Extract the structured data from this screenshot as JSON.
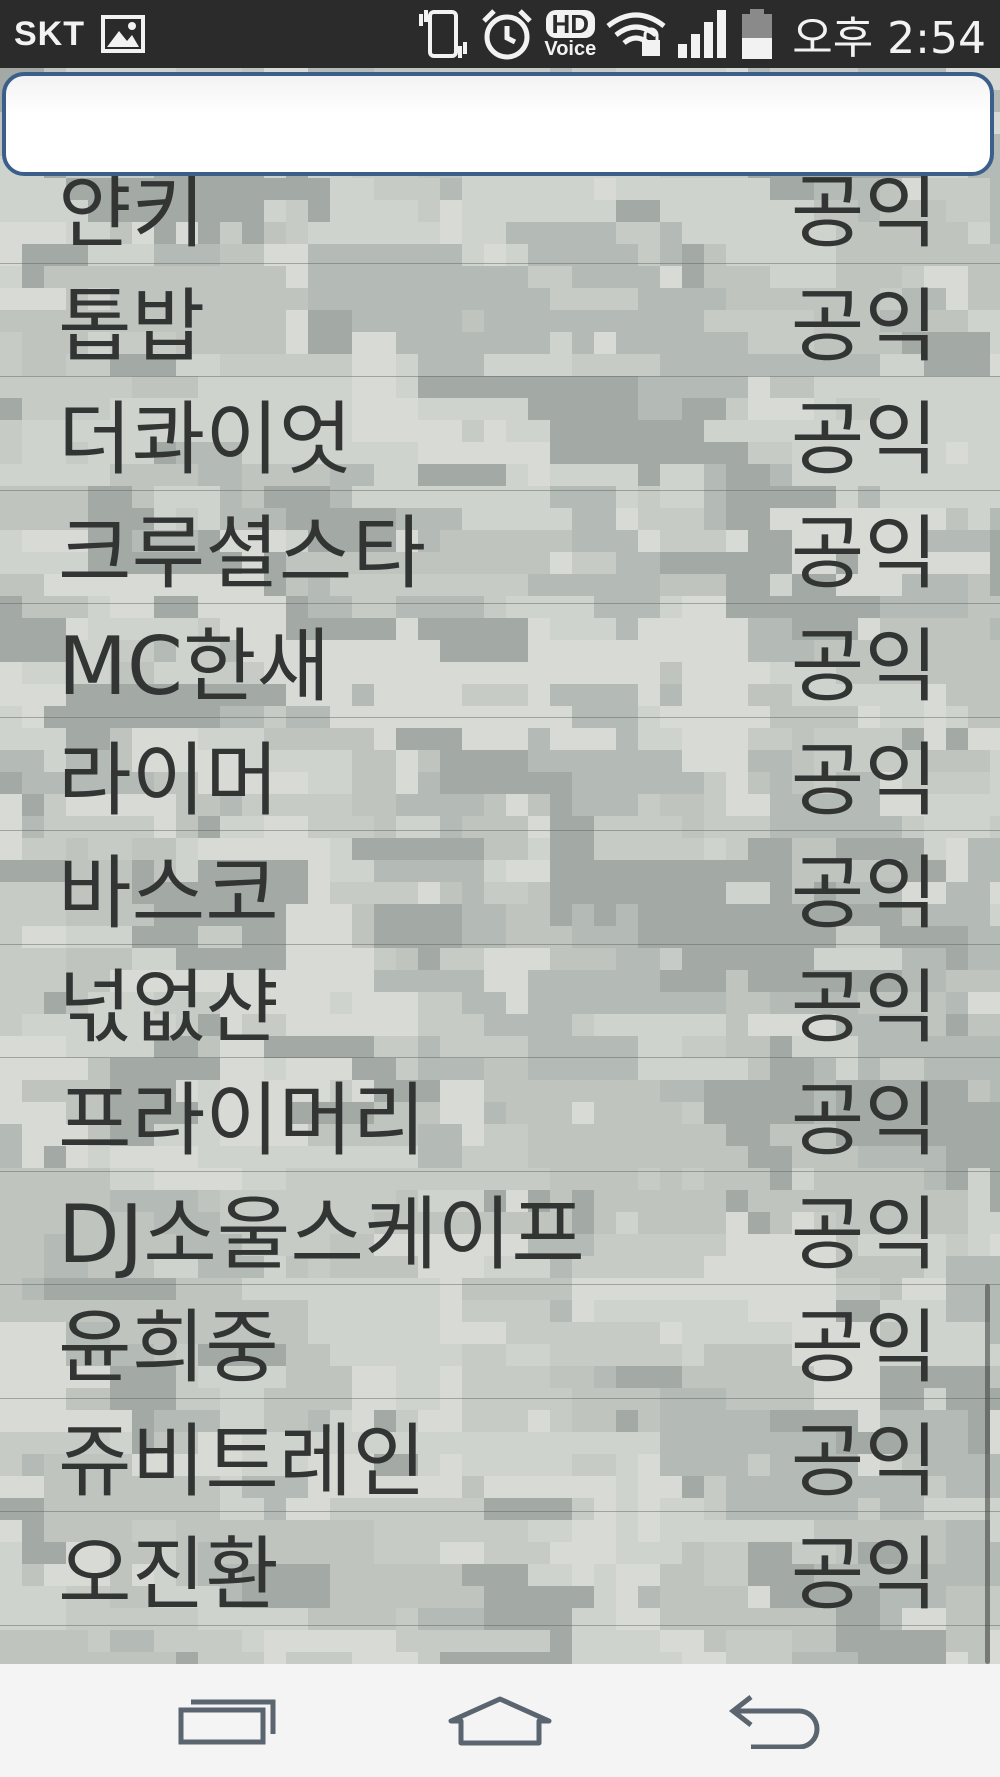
{
  "status_bar": {
    "carrier": "SKT",
    "hd_label": "HD",
    "voice_label": "Voice",
    "time": "오후 2:54",
    "icons": [
      "gallery-icon",
      "vibrate-icon",
      "alarm-icon",
      "hd-voice-icon",
      "wifi-locked-icon",
      "signal-icon",
      "battery-icon"
    ]
  },
  "search": {
    "value": "",
    "placeholder": ""
  },
  "list": {
    "items": [
      {
        "name": "얀키",
        "type": "공익"
      },
      {
        "name": "톱밥",
        "type": "공익"
      },
      {
        "name": "더콰이엇",
        "type": "공익"
      },
      {
        "name": "크루셜스타",
        "type": "공익"
      },
      {
        "name": "MC한새",
        "type": "공익"
      },
      {
        "name": "라이머",
        "type": "공익"
      },
      {
        "name": "바스코",
        "type": "공익"
      },
      {
        "name": "넋없샨",
        "type": "공익"
      },
      {
        "name": "프라이머리",
        "type": "공익"
      },
      {
        "name": "DJ소울스케이프",
        "type": "공익"
      },
      {
        "name": "윤희중",
        "type": "공익"
      },
      {
        "name": "쥬비트레인",
        "type": "공익"
      },
      {
        "name": "오진환",
        "type": "공익"
      }
    ]
  },
  "nav_bar": {
    "icons": [
      "recent-apps-icon",
      "home-icon",
      "back-icon"
    ]
  },
  "colors": {
    "status_bar_bg": "#2b2b2b",
    "search_border": "#3b5f8a",
    "text": "#333535",
    "nav_bg": "#f4f4f4"
  }
}
